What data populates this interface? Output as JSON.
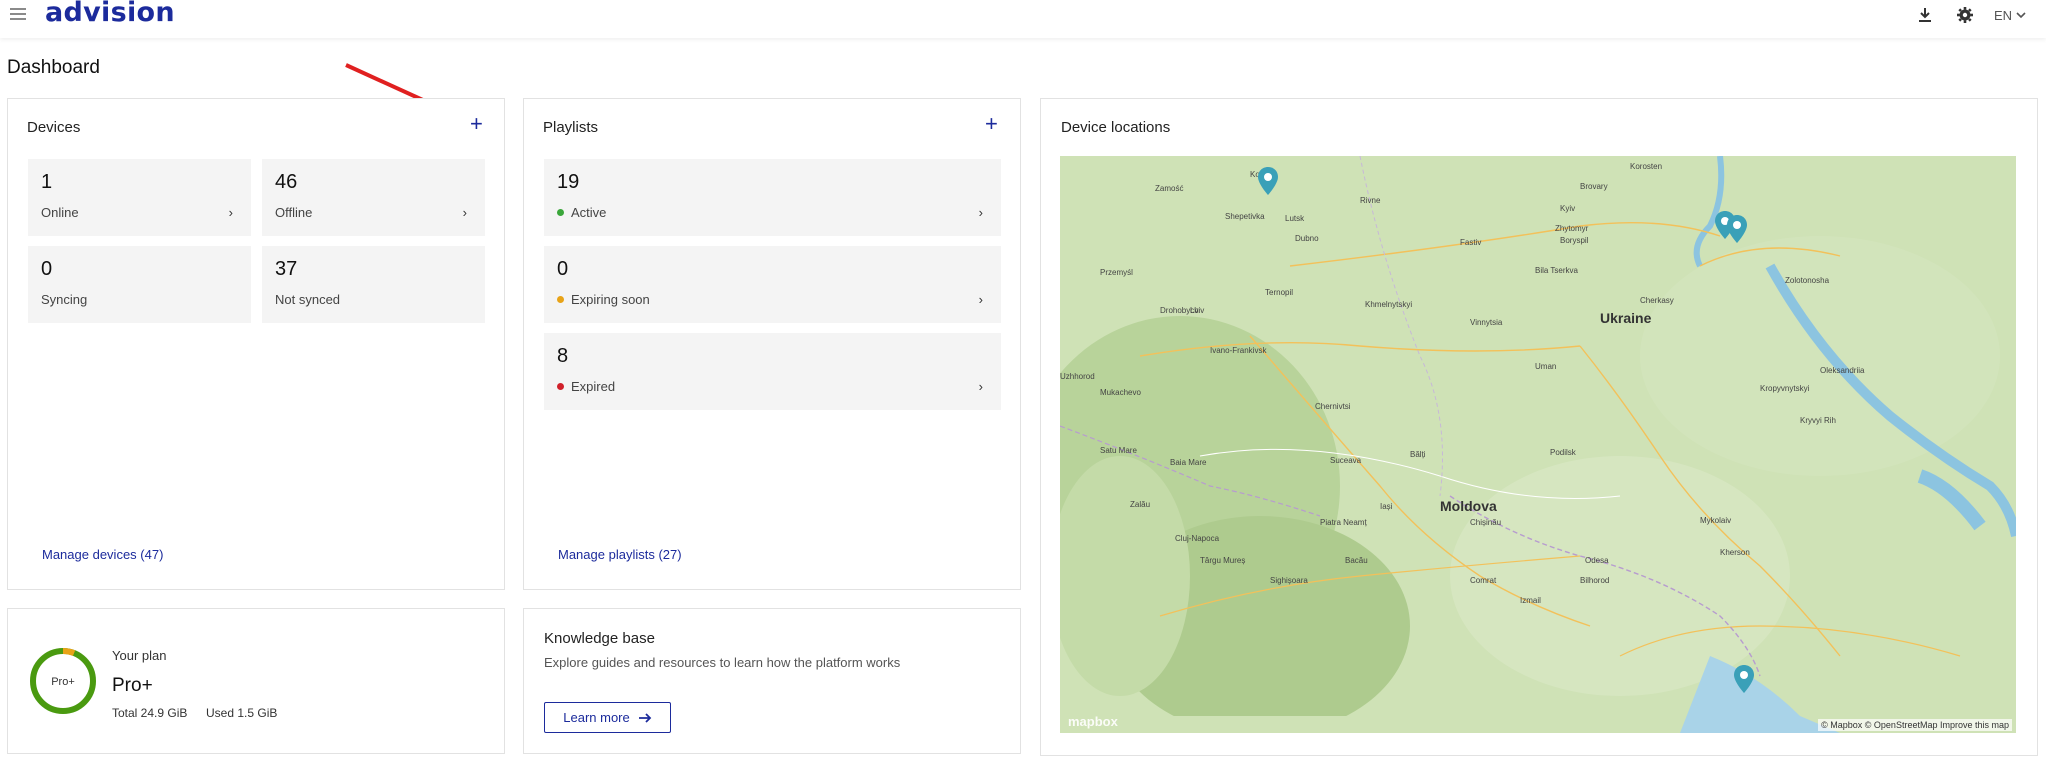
{
  "app": {
    "logo": "advision"
  },
  "topbar": {
    "language": "EN"
  },
  "page": {
    "title": "Dashboard"
  },
  "devices": {
    "title": "Devices",
    "tiles": [
      {
        "count": "1",
        "label": "Online"
      },
      {
        "count": "46",
        "label": "Offline"
      },
      {
        "count": "0",
        "label": "Syncing"
      },
      {
        "count": "37",
        "label": "Not synced"
      }
    ],
    "manage_link": "Manage devices (47)"
  },
  "playlists": {
    "title": "Playlists",
    "tiles": [
      {
        "count": "19",
        "label": "Active",
        "status_color": "#3aa63a"
      },
      {
        "count": "0",
        "label": "Expiring soon",
        "status_color": "#e8a317"
      },
      {
        "count": "8",
        "label": "Expired",
        "status_color": "#d0202a"
      }
    ],
    "manage_link": "Manage playlists (27)"
  },
  "locations": {
    "title": "Device locations",
    "map_labels": [
      "Kovel",
      "Zamość",
      "Lutsk",
      "Rivne",
      "Kyiv",
      "Zhytomyr",
      "Korosten",
      "Ukraine",
      "Cherkasy",
      "Lviv",
      "Ternopil",
      "Khmelnytskyi",
      "Vinnytsia",
      "Bila Tserkva",
      "Uman",
      "Ivano-Frankivsk",
      "Chernivtsi",
      "Kropyvnytskyi",
      "Moldova",
      "Chișinău",
      "Bălți",
      "Odesa",
      "Mykolaiv",
      "Kherson",
      "Iași",
      "Suceava",
      "Satu Mare",
      "Baia Mare",
      "Cluj-Napoca",
      "Uzhhorod",
      "Mukachevo",
      "Drohobych",
      "Przemyśl",
      "Brovary",
      "Boryspil",
      "Fastiv",
      "Oleksandriia",
      "Zolotonosha",
      "Piatra Neamț",
      "Bacău",
      "Bilhorod",
      "Târgu Mureș",
      "Zalău",
      "Izmail",
      "Comrat",
      "Kryvyi Rih",
      "Podilsk",
      "Sighișoara",
      "Shepetivka",
      "Dubno"
    ],
    "attribution": "© Mapbox © OpenStreetMap Improve this map",
    "mapbox_logo": "mapbox"
  },
  "plan": {
    "ring_label": "Pro+",
    "heading": "Your plan",
    "name": "Pro+",
    "total": "Total 24.9 GiB",
    "used": "Used 1.5 GiB",
    "used_fraction": 0.06
  },
  "knowledge": {
    "title": "Knowledge base",
    "description": "Explore guides and resources to learn how the platform works",
    "button": "Learn more"
  },
  "colors": {
    "brand": "#1c2b9c",
    "ring_green": "#4a9a10",
    "ring_used": "#e8a317",
    "annotation_arrow": "#e02020"
  }
}
